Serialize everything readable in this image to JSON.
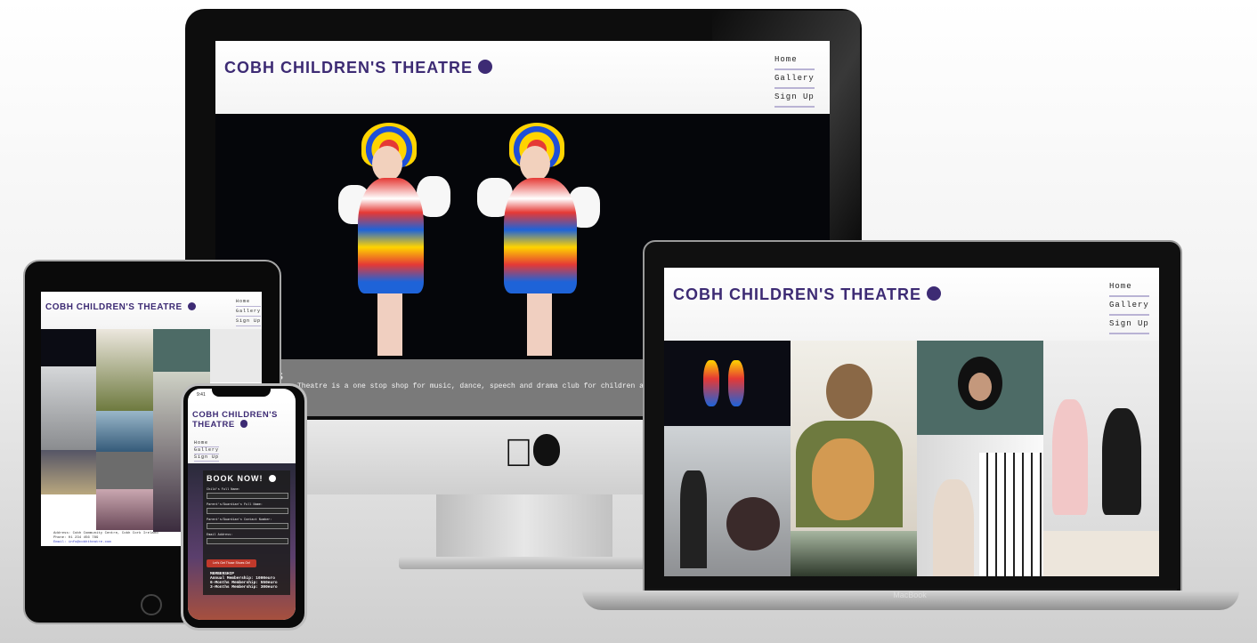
{
  "site": {
    "title": "COBH CHILDREN'S THEATRE",
    "nav": [
      "Home",
      "Gallery",
      "Sign Up"
    ],
    "hero_caption": "Theatre is a one stop shop for music, dance, speech and drama club for children a",
    "hero_caption_prefix": "S"
  },
  "devices": {
    "laptop_label": "MacBook",
    "phone_time": "9:41"
  },
  "phone": {
    "title_line1": "COBH CHILDREN'S",
    "title_line2": "THEATRE",
    "book_title": "BOOK NOW!",
    "fields": [
      "Child's Full Name:",
      "Parent's/Guardian's Full Name:",
      "Parent's/Guardian's Contact Number:",
      "Email Address:"
    ],
    "submit_label": "Let's Get Those Shoes On!",
    "membership_title": "MEMBERSHIP",
    "membership_lines": [
      "Annual Membership: 1000euro",
      "6-Months Membership: 550euro",
      "3-Months Membership: 300euro"
    ]
  },
  "ipad": {
    "footer_lines": [
      "Address: Cobh Community Centre, Cobh Cork Ireland",
      "Phone: 01 234 456 789",
      "Email: info@cobhtheatre.com"
    ]
  },
  "colors": {
    "brand": "#3d2b74",
    "stage": "#05060a",
    "book_panel": "#1d1d1d",
    "button": "#c0392b"
  }
}
